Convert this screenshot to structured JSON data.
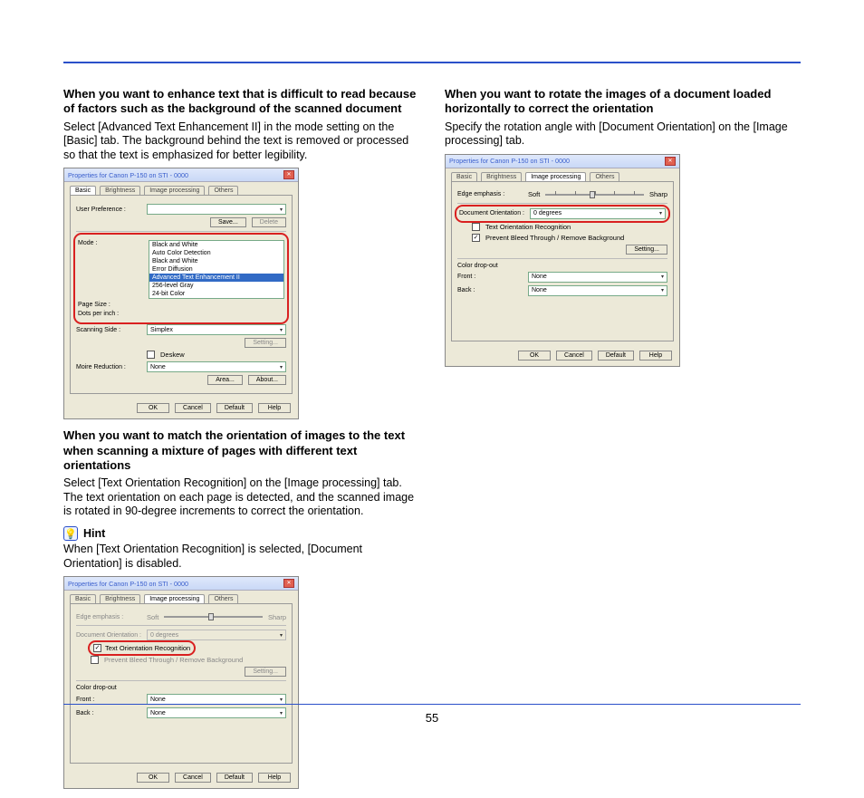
{
  "page_number": "55",
  "left": {
    "sec1_head": "When you want to enhance text that is difficult to read because of factors such as the background of the scanned document",
    "sec1_body": "Select [Advanced Text Enhancement II] in the mode setting on the [Basic] tab. The background behind the text is removed or processed so that the text is emphasized for better legibility.",
    "sec2_head": "When you want to match the orientation of images to the text when scanning a mixture of pages with different text orientations",
    "sec2_body": "Select [Text Orientation Recognition] on the [Image processing] tab. The text orientation on each page is detected, and the scanned image is rotated in 90-degree increments to correct the orientation.",
    "hint_label": "Hint",
    "hint_body": "When [Text Orientation Recognition] is selected, [Document Orientation] is disabled."
  },
  "right": {
    "sec1_head": "When you want to rotate the images of a document loaded horizontally to correct the orientation",
    "sec1_body": "Specify the rotation angle with [Document Orientation] on the [Image processing] tab."
  },
  "dlg_common": {
    "title": "Properties for Canon P-150 on STI - 0000",
    "tabs": {
      "basic": "Basic",
      "brightness": "Brightness",
      "image": "Image processing",
      "others": "Others"
    },
    "btn_ok": "OK",
    "btn_cancel": "Cancel",
    "btn_default": "Default",
    "btn_help": "Help",
    "btn_save": "Save...",
    "btn_delete": "Delete",
    "btn_area": "Area...",
    "btn_about": "About...",
    "btn_setting": "Setting..."
  },
  "dlg1": {
    "userpref": "User Preference :",
    "mode": "Mode :",
    "pagesize": "Page Size :",
    "dpi": "Dots per inch :",
    "scanside": "Scanning Side :",
    "deskew": "Deskew",
    "moire": "Moire Reduction :",
    "mode_items": [
      "Black and White",
      "Auto Color Detection",
      "Black and White",
      "Error Diffusion",
      "Advanced Text Enhancement II",
      "256-level Gray",
      "24-bit Color"
    ],
    "moire_val": "None",
    "scanside_val": "Simplex"
  },
  "dlg2": {
    "edge": "Edge emphasis :",
    "edge_soft": "Soft",
    "edge_sharp": "Sharp",
    "docorient": "Document Orientation :",
    "docorient_val": "0 degrees",
    "txtorient": "Text Orientation Recognition",
    "bleed": "Prevent Bleed Through / Remove Background",
    "colordrop": "Color drop-out",
    "front": "Front :",
    "back": "Back :",
    "none": "None"
  },
  "dlg3": {
    "edge": "Edge emphasis :",
    "edge_soft": "Soft",
    "edge_sharp": "Sharp",
    "docorient": "Document Orientation :",
    "docorient_val": "0 degrees",
    "txtorient": "Text Orientation Recognition",
    "bleed": "Prevent Bleed Through / Remove Background",
    "colordrop": "Color drop-out",
    "front": "Front :",
    "back": "Back :",
    "none": "None"
  }
}
